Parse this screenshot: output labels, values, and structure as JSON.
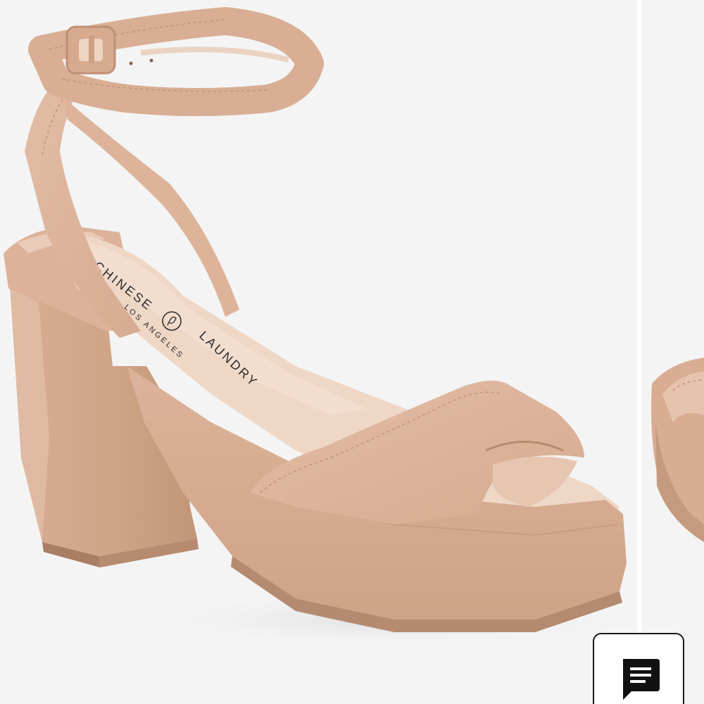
{
  "product_image": {
    "brand_line1": "CHINESE",
    "brand_line2": "LAUNDRY",
    "brand_sub": "LOS ANGELES"
  },
  "chat_button": {
    "icon": "chat-message-icon"
  },
  "colors": {
    "suede": "#d9ad93",
    "background": "#f4f4f4",
    "insole": "#eed4c2"
  }
}
